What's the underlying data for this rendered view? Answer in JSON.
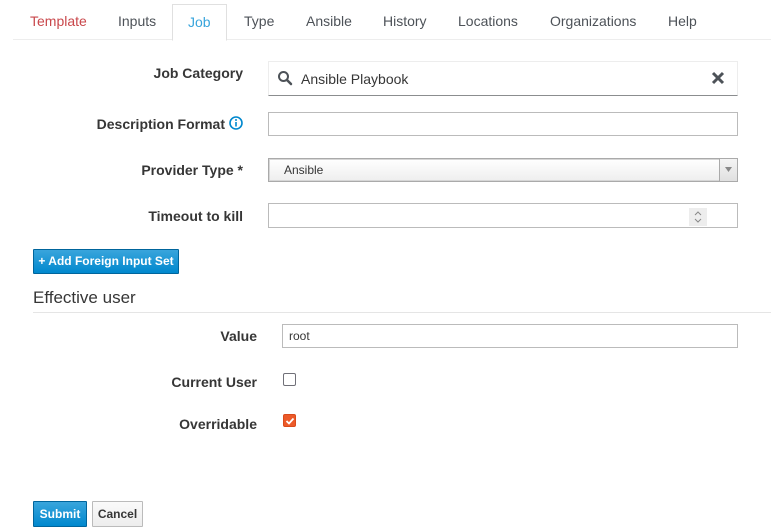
{
  "tabs": [
    {
      "label": "Template",
      "state": "error"
    },
    {
      "label": "Inputs",
      "state": "normal"
    },
    {
      "label": "Job",
      "state": "active"
    },
    {
      "label": "Type",
      "state": "normal"
    },
    {
      "label": "Ansible",
      "state": "normal"
    },
    {
      "label": "History",
      "state": "normal"
    },
    {
      "label": "Locations",
      "state": "normal"
    },
    {
      "label": "Organizations",
      "state": "normal"
    },
    {
      "label": "Help",
      "state": "normal"
    }
  ],
  "form": {
    "job_category": {
      "label": "Job Category",
      "value": "Ansible Playbook",
      "icon": "search-icon",
      "clear_icon": "close-icon"
    },
    "description_format": {
      "label": "Description Format",
      "value": "",
      "icon": "info-icon"
    },
    "provider_type": {
      "label": "Provider Type *",
      "value": "Ansible"
    },
    "timeout_to_kill": {
      "label": "Timeout to kill",
      "value": ""
    },
    "add_foreign_input_set": "+ Add Foreign Input Set"
  },
  "effective_user": {
    "title": "Effective user",
    "value": {
      "label": "Value",
      "value": "root"
    },
    "current_user": {
      "label": "Current User",
      "checked": false
    },
    "overridable": {
      "label": "Overridable",
      "checked": true
    }
  },
  "actions": {
    "submit": "Submit",
    "cancel": "Cancel"
  },
  "colors": {
    "active_tab": "#39a5dc",
    "error_tab": "#c9474b",
    "primary": "#0088ce",
    "checkbox_checked": "#ec5a29"
  }
}
